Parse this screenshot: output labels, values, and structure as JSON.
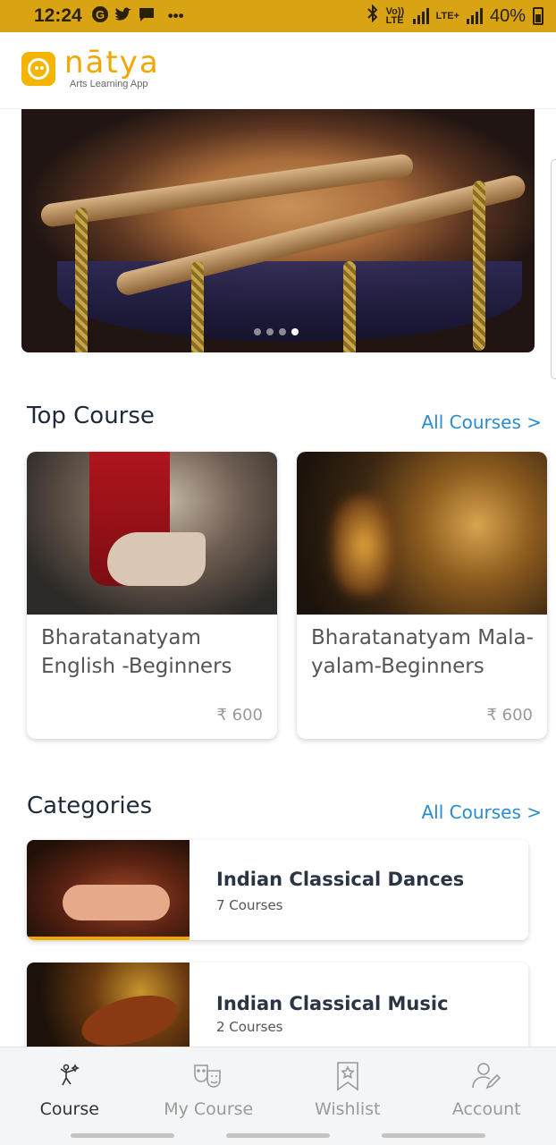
{
  "status_bar": {
    "time": "12:24",
    "left_icons": [
      "g-icon",
      "twitter-icon",
      "chat-icon",
      "more-icon"
    ],
    "volte": "Vo)) LTE",
    "lte": "LTE+",
    "battery": "40%"
  },
  "app": {
    "logo_text": "nātya",
    "logo_subtitle": "Arts Learning App",
    "brand_color": "#f0a800"
  },
  "banner": {
    "slide_count": 4,
    "active_slide": 4
  },
  "top_course": {
    "title": "Top Course",
    "link": "All Courses >",
    "courses": [
      {
        "title": "Bharatanatyam English -Beginners",
        "price": "₹ 600"
      },
      {
        "title": "Bharatanatyam Mala-yalam-Beginners",
        "price": "₹ 600"
      }
    ]
  },
  "categories": {
    "title": "Categories",
    "link": "All Courses >",
    "items": [
      {
        "title": "Indian Classical Dances",
        "count": "7 Courses"
      },
      {
        "title": "Indian Classical Music",
        "count": "2 Courses"
      }
    ]
  },
  "bottom_nav": {
    "items": [
      {
        "label": "Course",
        "icon": "dancer-icon",
        "active": true
      },
      {
        "label": "My Course",
        "icon": "theatre-masks-icon",
        "active": false
      },
      {
        "label": "Wishlist",
        "icon": "bookmark-star-icon",
        "active": false
      },
      {
        "label": "Account",
        "icon": "user-edit-icon",
        "active": false
      }
    ]
  }
}
